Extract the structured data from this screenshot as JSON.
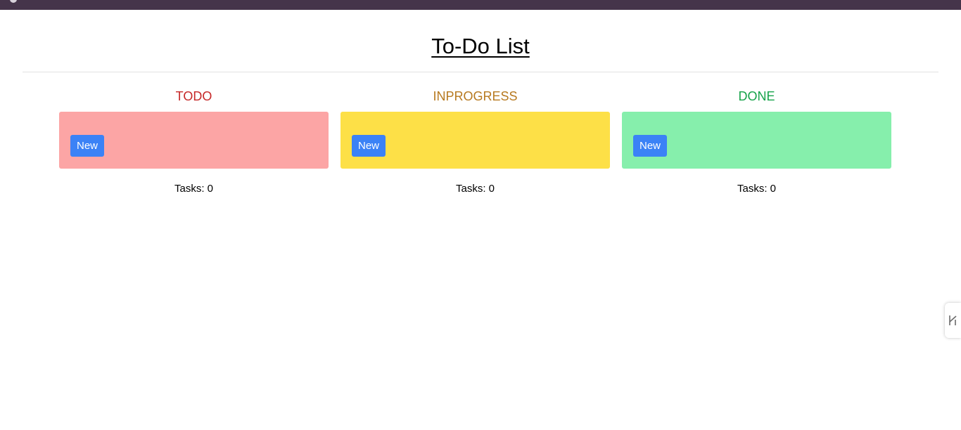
{
  "page": {
    "title": "To-Do List"
  },
  "columns": [
    {
      "heading": "TODO",
      "heading_color": "#c62828",
      "box_color": "#fca5a5",
      "new_button_label": "New",
      "task_count": "Tasks: 0"
    },
    {
      "heading": "INPROGRESS",
      "heading_color": "#b7791f",
      "box_color": "#fde047",
      "new_button_label": "New",
      "task_count": "Tasks: 0"
    },
    {
      "heading": "DONE",
      "heading_color": "#16a34a",
      "box_color": "#86efac",
      "new_button_label": "New",
      "task_count": "Tasks: 0"
    }
  ],
  "theme": {
    "accent": "#3b82f6",
    "top_bar": "#45344a"
  },
  "side_tab": {
    "icon": "extension-handle-icon"
  }
}
